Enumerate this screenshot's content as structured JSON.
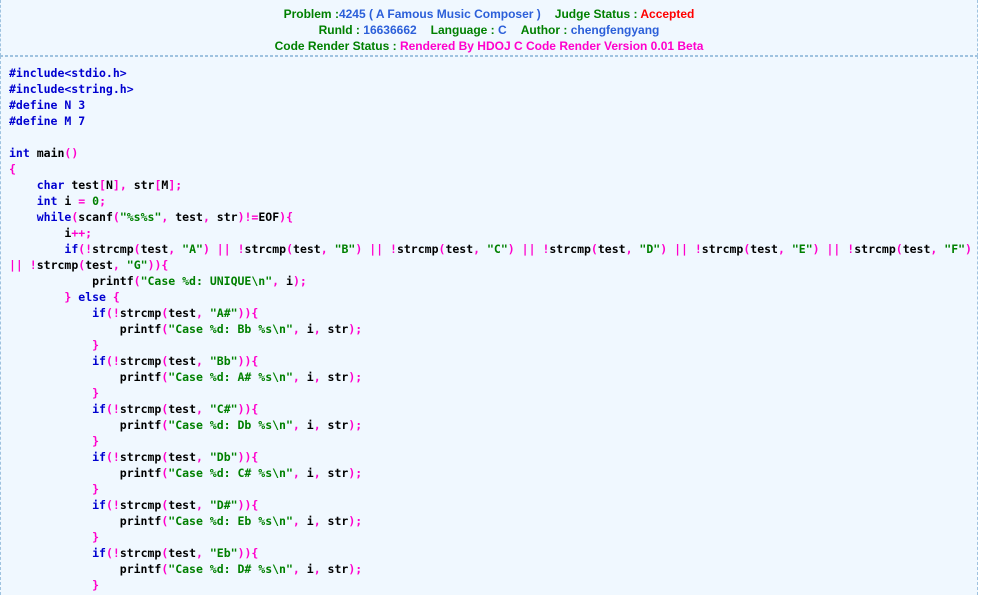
{
  "header": {
    "problem_label": "Problem :",
    "problem_id": "4245",
    "problem_title": "( A Famous Music Composer )",
    "judge_status_label": "Judge Status :",
    "judge_status_value": "Accepted",
    "runid_label": "RunId :",
    "runid_value": "16636662",
    "language_label": "Language :",
    "language_value": "C",
    "author_label": "Author :",
    "author_value": "chengfengyang",
    "code_render_status_label": "Code Render Status :",
    "code_render_status_value": "Rendered By HDOJ C Code Render Version 0.01 Beta"
  },
  "colors": {
    "label_green": "#008000",
    "value_blue": "#2b5fd9",
    "status_red": "#ff0000",
    "render_magenta": "#ff00cc",
    "page_background": "#f0f8ff",
    "border_dashed": "#9fc3e0",
    "code_keyword": "#0000d0",
    "code_punct": "#ff00cc",
    "code_string": "#008000",
    "code_identifier": "#000000"
  },
  "code": {
    "language": "C",
    "tokens": [
      [
        [
          "pp",
          "#include<stdio.h>"
        ]
      ],
      [
        [
          "pp",
          "#include<string.h>"
        ]
      ],
      [
        [
          "pp",
          "#define N 3"
        ]
      ],
      [
        [
          "pp",
          "#define M 7"
        ]
      ],
      [],
      [
        [
          "k",
          "int"
        ],
        [
          "id",
          " "
        ],
        [
          "fn",
          "main"
        ],
        [
          "p",
          "()"
        ]
      ],
      [
        [
          "p",
          "{"
        ]
      ],
      [
        [
          "id",
          "    "
        ],
        [
          "k",
          "char"
        ],
        [
          "id",
          " test"
        ],
        [
          "p",
          "["
        ],
        [
          "id",
          "N"
        ],
        [
          "p",
          "],"
        ],
        [
          "id",
          " str"
        ],
        [
          "p",
          "["
        ],
        [
          "id",
          "M"
        ],
        [
          "p",
          "];"
        ]
      ],
      [
        [
          "id",
          "    "
        ],
        [
          "k",
          "int"
        ],
        [
          "id",
          " i "
        ],
        [
          "p",
          "="
        ],
        [
          "n",
          " 0"
        ],
        [
          "p",
          ";"
        ]
      ],
      [
        [
          "id",
          "    "
        ],
        [
          "k",
          "while"
        ],
        [
          "p",
          "("
        ],
        [
          "fn",
          "scanf"
        ],
        [
          "p",
          "("
        ],
        [
          "s",
          "\"%s%s\""
        ],
        [
          "p",
          ","
        ],
        [
          "id",
          " test"
        ],
        [
          "p",
          ","
        ],
        [
          "id",
          " str"
        ],
        [
          "p",
          ")!="
        ],
        [
          "id",
          "EOF"
        ],
        [
          "p",
          "){"
        ]
      ],
      [
        [
          "id",
          "        i"
        ],
        [
          "p",
          "++;"
        ]
      ],
      [
        [
          "id",
          "        "
        ],
        [
          "k",
          "if"
        ],
        [
          "p",
          "(!"
        ],
        [
          "fn",
          "strcmp"
        ],
        [
          "p",
          "("
        ],
        [
          "id",
          "test"
        ],
        [
          "p",
          ","
        ],
        [
          "s",
          " \"A\""
        ],
        [
          "p",
          ") "
        ],
        [
          "p",
          "||"
        ],
        [
          "id",
          " "
        ],
        [
          "p",
          "!"
        ],
        [
          "fn",
          "strcmp"
        ],
        [
          "p",
          "("
        ],
        [
          "id",
          "test"
        ],
        [
          "p",
          ","
        ],
        [
          "s",
          " \"B\""
        ],
        [
          "p",
          ") "
        ],
        [
          "p",
          "||"
        ],
        [
          "id",
          " "
        ],
        [
          "p",
          "!"
        ],
        [
          "fn",
          "strcmp"
        ],
        [
          "p",
          "("
        ],
        [
          "id",
          "test"
        ],
        [
          "p",
          ","
        ],
        [
          "s",
          " \"C\""
        ],
        [
          "p",
          ") "
        ],
        [
          "p",
          "||"
        ],
        [
          "id",
          " "
        ],
        [
          "p",
          "!"
        ],
        [
          "fn",
          "strcmp"
        ],
        [
          "p",
          "("
        ],
        [
          "id",
          "test"
        ],
        [
          "p",
          ","
        ],
        [
          "s",
          " \"D\""
        ],
        [
          "p",
          ") "
        ],
        [
          "p",
          "||"
        ],
        [
          "id",
          " "
        ],
        [
          "p",
          "!"
        ],
        [
          "fn",
          "strcmp"
        ],
        [
          "p",
          "("
        ],
        [
          "id",
          "test"
        ],
        [
          "p",
          ","
        ],
        [
          "s",
          " \"E\""
        ],
        [
          "p",
          ") "
        ],
        [
          "p",
          "||"
        ],
        [
          "id",
          " "
        ],
        [
          "p",
          "!"
        ],
        [
          "fn",
          "strcmp"
        ],
        [
          "p",
          "("
        ],
        [
          "id",
          "test"
        ],
        [
          "p",
          ","
        ],
        [
          "s",
          " \"F\""
        ],
        [
          "p",
          ") "
        ],
        [
          "p",
          "||"
        ],
        [
          "id",
          " "
        ],
        [
          "p",
          "!"
        ],
        [
          "fn",
          "strcmp"
        ],
        [
          "p",
          "("
        ],
        [
          "id",
          "test"
        ],
        [
          "p",
          ","
        ],
        [
          "s",
          " \"G\""
        ],
        [
          "p",
          ")){"
        ]
      ],
      [
        [
          "id",
          "            "
        ],
        [
          "fn",
          "printf"
        ],
        [
          "p",
          "("
        ],
        [
          "s",
          "\"Case %d: UNIQUE\\n\""
        ],
        [
          "p",
          ","
        ],
        [
          "id",
          " i"
        ],
        [
          "p",
          ");"
        ]
      ],
      [
        [
          "id",
          "        "
        ],
        [
          "p",
          "}"
        ],
        [
          "id",
          " "
        ],
        [
          "k",
          "else"
        ],
        [
          "id",
          " "
        ],
        [
          "p",
          "{"
        ]
      ],
      [
        [
          "id",
          "            "
        ],
        [
          "k",
          "if"
        ],
        [
          "p",
          "(!"
        ],
        [
          "fn",
          "strcmp"
        ],
        [
          "p",
          "("
        ],
        [
          "id",
          "test"
        ],
        [
          "p",
          ","
        ],
        [
          "s",
          " \"A#\""
        ],
        [
          "p",
          ")){"
        ]
      ],
      [
        [
          "id",
          "                "
        ],
        [
          "fn",
          "printf"
        ],
        [
          "p",
          "("
        ],
        [
          "s",
          "\"Case %d: Bb %s\\n\""
        ],
        [
          "p",
          ","
        ],
        [
          "id",
          " i"
        ],
        [
          "p",
          ","
        ],
        [
          "id",
          " str"
        ],
        [
          "p",
          ");"
        ]
      ],
      [
        [
          "id",
          "            "
        ],
        [
          "p",
          "}"
        ]
      ],
      [
        [
          "id",
          "            "
        ],
        [
          "k",
          "if"
        ],
        [
          "p",
          "(!"
        ],
        [
          "fn",
          "strcmp"
        ],
        [
          "p",
          "("
        ],
        [
          "id",
          "test"
        ],
        [
          "p",
          ","
        ],
        [
          "s",
          " \"Bb\""
        ],
        [
          "p",
          ")){"
        ]
      ],
      [
        [
          "id",
          "                "
        ],
        [
          "fn",
          "printf"
        ],
        [
          "p",
          "("
        ],
        [
          "s",
          "\"Case %d: A# %s\\n\""
        ],
        [
          "p",
          ","
        ],
        [
          "id",
          " i"
        ],
        [
          "p",
          ","
        ],
        [
          "id",
          " str"
        ],
        [
          "p",
          ");"
        ]
      ],
      [
        [
          "id",
          "            "
        ],
        [
          "p",
          "}"
        ]
      ],
      [
        [
          "id",
          "            "
        ],
        [
          "k",
          "if"
        ],
        [
          "p",
          "(!"
        ],
        [
          "fn",
          "strcmp"
        ],
        [
          "p",
          "("
        ],
        [
          "id",
          "test"
        ],
        [
          "p",
          ","
        ],
        [
          "s",
          " \"C#\""
        ],
        [
          "p",
          ")){"
        ]
      ],
      [
        [
          "id",
          "                "
        ],
        [
          "fn",
          "printf"
        ],
        [
          "p",
          "("
        ],
        [
          "s",
          "\"Case %d: Db %s\\n\""
        ],
        [
          "p",
          ","
        ],
        [
          "id",
          " i"
        ],
        [
          "p",
          ","
        ],
        [
          "id",
          " str"
        ],
        [
          "p",
          ");"
        ]
      ],
      [
        [
          "id",
          "            "
        ],
        [
          "p",
          "}"
        ]
      ],
      [
        [
          "id",
          "            "
        ],
        [
          "k",
          "if"
        ],
        [
          "p",
          "(!"
        ],
        [
          "fn",
          "strcmp"
        ],
        [
          "p",
          "("
        ],
        [
          "id",
          "test"
        ],
        [
          "p",
          ","
        ],
        [
          "s",
          " \"Db\""
        ],
        [
          "p",
          ")){"
        ]
      ],
      [
        [
          "id",
          "                "
        ],
        [
          "fn",
          "printf"
        ],
        [
          "p",
          "("
        ],
        [
          "s",
          "\"Case %d: C# %s\\n\""
        ],
        [
          "p",
          ","
        ],
        [
          "id",
          " i"
        ],
        [
          "p",
          ","
        ],
        [
          "id",
          " str"
        ],
        [
          "p",
          ");"
        ]
      ],
      [
        [
          "id",
          "            "
        ],
        [
          "p",
          "}"
        ]
      ],
      [
        [
          "id",
          "            "
        ],
        [
          "k",
          "if"
        ],
        [
          "p",
          "(!"
        ],
        [
          "fn",
          "strcmp"
        ],
        [
          "p",
          "("
        ],
        [
          "id",
          "test"
        ],
        [
          "p",
          ","
        ],
        [
          "s",
          " \"D#\""
        ],
        [
          "p",
          ")){"
        ]
      ],
      [
        [
          "id",
          "                "
        ],
        [
          "fn",
          "printf"
        ],
        [
          "p",
          "("
        ],
        [
          "s",
          "\"Case %d: Eb %s\\n\""
        ],
        [
          "p",
          ","
        ],
        [
          "id",
          " i"
        ],
        [
          "p",
          ","
        ],
        [
          "id",
          " str"
        ],
        [
          "p",
          ");"
        ]
      ],
      [
        [
          "id",
          "            "
        ],
        [
          "p",
          "}"
        ]
      ],
      [
        [
          "id",
          "            "
        ],
        [
          "k",
          "if"
        ],
        [
          "p",
          "(!"
        ],
        [
          "fn",
          "strcmp"
        ],
        [
          "p",
          "("
        ],
        [
          "id",
          "test"
        ],
        [
          "p",
          ","
        ],
        [
          "s",
          " \"Eb\""
        ],
        [
          "p",
          ")){"
        ]
      ],
      [
        [
          "id",
          "                "
        ],
        [
          "fn",
          "printf"
        ],
        [
          "p",
          "("
        ],
        [
          "s",
          "\"Case %d: D# %s\\n\""
        ],
        [
          "p",
          ","
        ],
        [
          "id",
          " i"
        ],
        [
          "p",
          ","
        ],
        [
          "id",
          " str"
        ],
        [
          "p",
          ");"
        ]
      ],
      [
        [
          "id",
          "            "
        ],
        [
          "p",
          "}"
        ]
      ]
    ]
  }
}
